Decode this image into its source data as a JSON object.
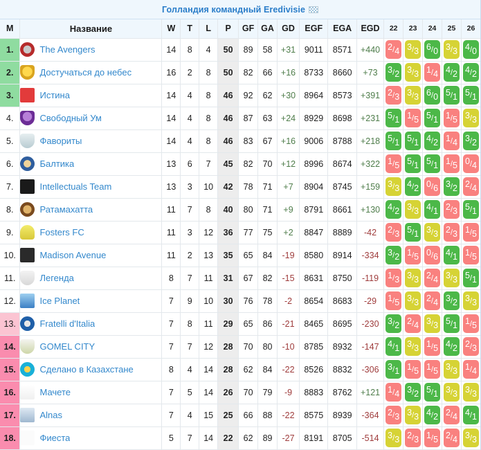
{
  "header": {
    "title": "Голландия командный Eredivisie",
    "flag_icon": "checkered-flag-icon"
  },
  "columns": {
    "rank": "M",
    "name": "Название",
    "w": "W",
    "t": "T",
    "l": "L",
    "p": "P",
    "gf": "GF",
    "ga": "GA",
    "gd": "GD",
    "egf": "EGF",
    "ega": "EGA",
    "egd": "EGD",
    "matchweeks": [
      "22",
      "23",
      "24",
      "25",
      "26"
    ]
  },
  "colors": {
    "promotion_green": "#8fdca0",
    "relegation_light_pink": "#fbc4d2",
    "relegation_pink": "#fa8cae",
    "win": "#4cb848",
    "draw": "#d6d335",
    "loss": "#f9817f",
    "link": "#3388cc",
    "positive": "#4f7d4b",
    "negative": "#9e3b3b",
    "header_bg": "#eff7fd"
  },
  "rows": [
    {
      "rank": "1.",
      "zone": "top",
      "logo": "lg-avengers",
      "team": "The Avengers",
      "w": "14",
      "t": "8",
      "l": "4",
      "p": "50",
      "gf": "89",
      "ga": "58",
      "gd": "+31",
      "egf": "9011",
      "ega": "8571",
      "egd": "+440",
      "matches": [
        {
          "a": "2",
          "b": "4",
          "r": "loss"
        },
        {
          "a": "3",
          "b": "3",
          "r": "draw"
        },
        {
          "a": "6",
          "b": "0",
          "r": "win"
        },
        {
          "a": "3",
          "b": "3",
          "r": "draw"
        },
        {
          "a": "4",
          "b": "0",
          "r": "win"
        }
      ]
    },
    {
      "rank": "2.",
      "zone": "top",
      "logo": "lg-heaven",
      "team": "Достучаться до небес",
      "w": "16",
      "t": "2",
      "l": "8",
      "p": "50",
      "gf": "82",
      "ga": "66",
      "gd": "+16",
      "egf": "8733",
      "ega": "8660",
      "egd": "+73",
      "matches": [
        {
          "a": "3",
          "b": "2",
          "r": "win"
        },
        {
          "a": "3",
          "b": "3",
          "r": "draw"
        },
        {
          "a": "1",
          "b": "4",
          "r": "loss"
        },
        {
          "a": "4",
          "b": "2",
          "r": "win"
        },
        {
          "a": "4",
          "b": "2",
          "r": "win"
        }
      ]
    },
    {
      "rank": "3.",
      "zone": "top",
      "logo": "lg-truth",
      "team": "Истина",
      "w": "14",
      "t": "4",
      "l": "8",
      "p": "46",
      "gf": "92",
      "ga": "62",
      "gd": "+30",
      "egf": "8964",
      "ega": "8573",
      "egd": "+391",
      "matches": [
        {
          "a": "2",
          "b": "3",
          "r": "loss"
        },
        {
          "a": "3",
          "b": "3",
          "r": "draw"
        },
        {
          "a": "6",
          "b": "0",
          "r": "win"
        },
        {
          "a": "5",
          "b": "1",
          "r": "win"
        },
        {
          "a": "5",
          "b": "1",
          "r": "win"
        }
      ]
    },
    {
      "rank": "4.",
      "zone": "mid",
      "logo": "lg-free",
      "team": "Свободный Ум",
      "w": "14",
      "t": "4",
      "l": "8",
      "p": "46",
      "gf": "87",
      "ga": "63",
      "gd": "+24",
      "egf": "8929",
      "ega": "8698",
      "egd": "+231",
      "matches": [
        {
          "a": "5",
          "b": "1",
          "r": "win"
        },
        {
          "a": "1",
          "b": "5",
          "r": "loss"
        },
        {
          "a": "5",
          "b": "1",
          "r": "win"
        },
        {
          "a": "1",
          "b": "5",
          "r": "loss"
        },
        {
          "a": "3",
          "b": "3",
          "r": "draw"
        }
      ]
    },
    {
      "rank": "5.",
      "zone": "mid",
      "logo": "lg-fav",
      "team": "Фавориты",
      "w": "14",
      "t": "4",
      "l": "8",
      "p": "46",
      "gf": "83",
      "ga": "67",
      "gd": "+16",
      "egf": "9006",
      "ega": "8788",
      "egd": "+218",
      "matches": [
        {
          "a": "5",
          "b": "1",
          "r": "win"
        },
        {
          "a": "5",
          "b": "1",
          "r": "win"
        },
        {
          "a": "4",
          "b": "2",
          "r": "win"
        },
        {
          "a": "1",
          "b": "4",
          "r": "loss"
        },
        {
          "a": "3",
          "b": "2",
          "r": "win"
        }
      ]
    },
    {
      "rank": "6.",
      "zone": "mid",
      "logo": "lg-baltika",
      "team": "Балтика",
      "w": "13",
      "t": "6",
      "l": "7",
      "p": "45",
      "gf": "82",
      "ga": "70",
      "gd": "+12",
      "egf": "8996",
      "ega": "8674",
      "egd": "+322",
      "matches": [
        {
          "a": "1",
          "b": "5",
          "r": "loss"
        },
        {
          "a": "5",
          "b": "1",
          "r": "win"
        },
        {
          "a": "5",
          "b": "1",
          "r": "win"
        },
        {
          "a": "1",
          "b": "5",
          "r": "loss"
        },
        {
          "a": "0",
          "b": "4",
          "r": "loss"
        }
      ]
    },
    {
      "rank": "7.",
      "zone": "mid",
      "logo": "lg-intel",
      "team": "Intellectuals Team",
      "w": "13",
      "t": "3",
      "l": "10",
      "p": "42",
      "gf": "78",
      "ga": "71",
      "gd": "+7",
      "egf": "8904",
      "ega": "8745",
      "egd": "+159",
      "matches": [
        {
          "a": "3",
          "b": "3",
          "r": "draw"
        },
        {
          "a": "4",
          "b": "2",
          "r": "win"
        },
        {
          "a": "0",
          "b": "6",
          "r": "loss"
        },
        {
          "a": "3",
          "b": "2",
          "r": "win"
        },
        {
          "a": "2",
          "b": "4",
          "r": "loss"
        }
      ]
    },
    {
      "rank": "8.",
      "zone": "mid",
      "logo": "lg-rata",
      "team": "Ратамахатта",
      "w": "11",
      "t": "7",
      "l": "8",
      "p": "40",
      "gf": "80",
      "ga": "71",
      "gd": "+9",
      "egf": "8791",
      "ega": "8661",
      "egd": "+130",
      "matches": [
        {
          "a": "4",
          "b": "2",
          "r": "win"
        },
        {
          "a": "3",
          "b": "3",
          "r": "draw"
        },
        {
          "a": "4",
          "b": "1",
          "r": "win"
        },
        {
          "a": "2",
          "b": "3",
          "r": "loss"
        },
        {
          "a": "5",
          "b": "1",
          "r": "win"
        }
      ]
    },
    {
      "rank": "9.",
      "zone": "mid",
      "logo": "lg-fosters",
      "team": "Fosters FC",
      "w": "11",
      "t": "3",
      "l": "12",
      "p": "36",
      "gf": "77",
      "ga": "75",
      "gd": "+2",
      "egf": "8847",
      "ega": "8889",
      "egd": "-42",
      "matches": [
        {
          "a": "2",
          "b": "3",
          "r": "loss"
        },
        {
          "a": "5",
          "b": "1",
          "r": "win"
        },
        {
          "a": "3",
          "b": "3",
          "r": "draw"
        },
        {
          "a": "2",
          "b": "3",
          "r": "loss"
        },
        {
          "a": "1",
          "b": "5",
          "r": "loss"
        }
      ]
    },
    {
      "rank": "10.",
      "zone": "mid",
      "logo": "lg-madison",
      "team": "Madison Avenue",
      "w": "11",
      "t": "2",
      "l": "13",
      "p": "35",
      "gf": "65",
      "ga": "84",
      "gd": "-19",
      "egf": "8580",
      "ega": "8914",
      "egd": "-334",
      "matches": [
        {
          "a": "3",
          "b": "2",
          "r": "win"
        },
        {
          "a": "1",
          "b": "5",
          "r": "loss"
        },
        {
          "a": "0",
          "b": "6",
          "r": "loss"
        },
        {
          "a": "4",
          "b": "1",
          "r": "win"
        },
        {
          "a": "1",
          "b": "5",
          "r": "loss"
        }
      ]
    },
    {
      "rank": "11.",
      "zone": "mid",
      "logo": "lg-legenda",
      "team": "Легенда",
      "w": "8",
      "t": "7",
      "l": "11",
      "p": "31",
      "gf": "67",
      "ga": "82",
      "gd": "-15",
      "egf": "8631",
      "ega": "8750",
      "egd": "-119",
      "matches": [
        {
          "a": "1",
          "b": "3",
          "r": "loss"
        },
        {
          "a": "3",
          "b": "3",
          "r": "draw"
        },
        {
          "a": "2",
          "b": "4",
          "r": "loss"
        },
        {
          "a": "3",
          "b": "3",
          "r": "draw"
        },
        {
          "a": "5",
          "b": "1",
          "r": "win"
        }
      ]
    },
    {
      "rank": "12.",
      "zone": "mid",
      "logo": "lg-ice",
      "team": "Ice Planet",
      "w": "7",
      "t": "9",
      "l": "10",
      "p": "30",
      "gf": "76",
      "ga": "78",
      "gd": "-2",
      "egf": "8654",
      "ega": "8683",
      "egd": "-29",
      "matches": [
        {
          "a": "1",
          "b": "5",
          "r": "loss"
        },
        {
          "a": "3",
          "b": "3",
          "r": "draw"
        },
        {
          "a": "2",
          "b": "4",
          "r": "loss"
        },
        {
          "a": "3",
          "b": "2",
          "r": "win"
        },
        {
          "a": "3",
          "b": "3",
          "r": "draw"
        }
      ]
    },
    {
      "rank": "13.",
      "zone": "relq",
      "logo": "lg-fratelli",
      "team": "Fratelli d'Italia",
      "w": "7",
      "t": "8",
      "l": "11",
      "p": "29",
      "gf": "65",
      "ga": "86",
      "gd": "-21",
      "egf": "8465",
      "ega": "8695",
      "egd": "-230",
      "matches": [
        {
          "a": "3",
          "b": "2",
          "r": "win"
        },
        {
          "a": "2",
          "b": "4",
          "r": "loss"
        },
        {
          "a": "3",
          "b": "3",
          "r": "draw"
        },
        {
          "a": "5",
          "b": "1",
          "r": "win"
        },
        {
          "a": "1",
          "b": "5",
          "r": "loss"
        }
      ]
    },
    {
      "rank": "14.",
      "zone": "rel",
      "logo": "lg-gomel",
      "team": "GOMEL CITY",
      "w": "7",
      "t": "7",
      "l": "12",
      "p": "28",
      "gf": "70",
      "ga": "80",
      "gd": "-10",
      "egf": "8785",
      "ega": "8932",
      "egd": "-147",
      "matches": [
        {
          "a": "4",
          "b": "1",
          "r": "win"
        },
        {
          "a": "3",
          "b": "3",
          "r": "draw"
        },
        {
          "a": "1",
          "b": "5",
          "r": "loss"
        },
        {
          "a": "4",
          "b": "2",
          "r": "win"
        },
        {
          "a": "2",
          "b": "3",
          "r": "loss"
        }
      ]
    },
    {
      "rank": "15.",
      "zone": "rel",
      "logo": "lg-kaz",
      "team": "Сделано в Казахстане",
      "w": "8",
      "t": "4",
      "l": "14",
      "p": "28",
      "gf": "62",
      "ga": "84",
      "gd": "-22",
      "egf": "8526",
      "ega": "8832",
      "egd": "-306",
      "matches": [
        {
          "a": "3",
          "b": "1",
          "r": "win"
        },
        {
          "a": "1",
          "b": "5",
          "r": "loss"
        },
        {
          "a": "1",
          "b": "5",
          "r": "loss"
        },
        {
          "a": "3",
          "b": "3",
          "r": "draw"
        },
        {
          "a": "1",
          "b": "4",
          "r": "loss"
        }
      ]
    },
    {
      "rank": "16.",
      "zone": "rel",
      "logo": "lg-machete",
      "team": "Мачете",
      "w": "7",
      "t": "5",
      "l": "14",
      "p": "26",
      "gf": "70",
      "ga": "79",
      "gd": "-9",
      "egf": "8883",
      "ega": "8762",
      "egd": "+121",
      "matches": [
        {
          "a": "1",
          "b": "4",
          "r": "loss"
        },
        {
          "a": "3",
          "b": "2",
          "r": "win"
        },
        {
          "a": "5",
          "b": "1",
          "r": "win"
        },
        {
          "a": "3",
          "b": "3",
          "r": "draw"
        },
        {
          "a": "3",
          "b": "3",
          "r": "draw"
        }
      ]
    },
    {
      "rank": "17.",
      "zone": "rel",
      "logo": "lg-alnas",
      "team": "Alnas",
      "w": "7",
      "t": "4",
      "l": "15",
      "p": "25",
      "gf": "66",
      "ga": "88",
      "gd": "-22",
      "egf": "8575",
      "ega": "8939",
      "egd": "-364",
      "matches": [
        {
          "a": "2",
          "b": "3",
          "r": "loss"
        },
        {
          "a": "3",
          "b": "3",
          "r": "draw"
        },
        {
          "a": "4",
          "b": "2",
          "r": "win"
        },
        {
          "a": "2",
          "b": "4",
          "r": "loss"
        },
        {
          "a": "4",
          "b": "1",
          "r": "win"
        }
      ]
    },
    {
      "rank": "18.",
      "zone": "rel",
      "logo": "lg-fiesta",
      "team": "Фиеста",
      "w": "5",
      "t": "7",
      "l": "14",
      "p": "22",
      "gf": "62",
      "ga": "89",
      "gd": "-27",
      "egf": "8191",
      "ega": "8705",
      "egd": "-514",
      "matches": [
        {
          "a": "3",
          "b": "3",
          "r": "draw"
        },
        {
          "a": "2",
          "b": "3",
          "r": "loss"
        },
        {
          "a": "1",
          "b": "5",
          "r": "loss"
        },
        {
          "a": "2",
          "b": "4",
          "r": "loss"
        },
        {
          "a": "3",
          "b": "3",
          "r": "draw"
        }
      ]
    }
  ]
}
